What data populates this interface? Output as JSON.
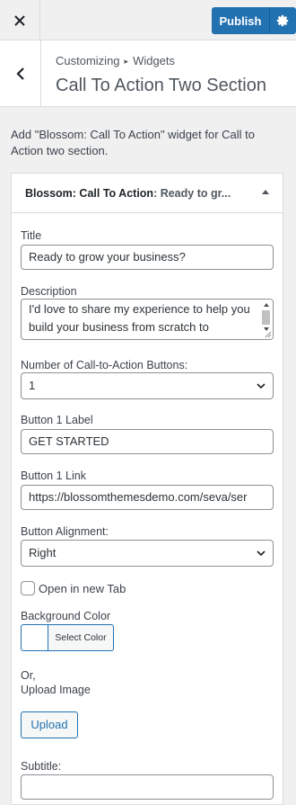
{
  "topbar": {
    "close_icon": "close-icon",
    "publish_label": "Publish",
    "settings_icon": "gear-icon",
    "accent_color": "#2271b1"
  },
  "header": {
    "breadcrumb_root": "Customizing",
    "breadcrumb_separator": "▸",
    "breadcrumb_current": "Widgets",
    "title": "Call To Action Two Section",
    "back_icon": "chevron-left-icon"
  },
  "section_description": "Add \"Blossom: Call To Action\" widget for Call to Action two section.",
  "widget": {
    "title_name": "Blossom: Call To Action",
    "title_instance": ": Ready to gr...",
    "toggle_icon": "arrow-up-icon",
    "fields": {
      "title": {
        "label": "Title",
        "value": "Ready to grow your business?"
      },
      "description": {
        "label": "Description",
        "value": "I'd love to share my experience to help you build your business from scratch to"
      },
      "num_buttons": {
        "label": "Number of Call-to-Action Buttons:",
        "value": "1"
      },
      "button1_label": {
        "label": "Button 1 Label",
        "value": "GET STARTED"
      },
      "button1_link": {
        "label": "Button 1 Link",
        "value": "https://blossomthemesdemo.com/seva/ser"
      },
      "button_alignment": {
        "label": "Button Alignment:",
        "value": "Right"
      },
      "new_tab": {
        "label": "Open in new Tab",
        "checked": false
      },
      "background_color": {
        "label": "Background Color",
        "button_label": "Select Color"
      },
      "or_label": "Or,",
      "upload_image": {
        "label": "Upload Image",
        "button_label": "Upload"
      },
      "subtitle": {
        "label": "Subtitle:",
        "value": ""
      }
    }
  }
}
